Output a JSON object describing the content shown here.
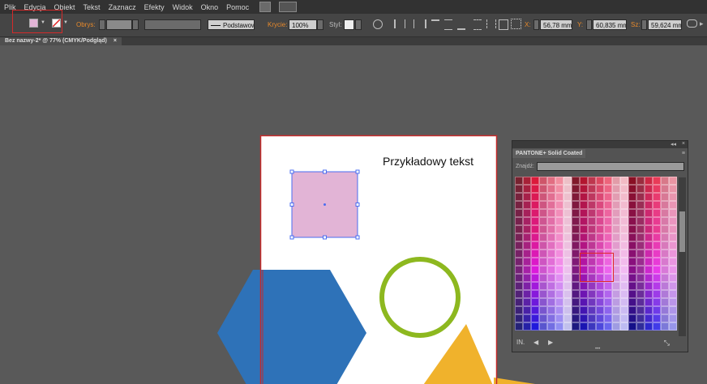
{
  "menu": {
    "items": [
      "Plik",
      "Edycja",
      "Obiekt",
      "Tekst",
      "Zaznacz",
      "Efekty",
      "Widok",
      "Okno",
      "Pomoc"
    ]
  },
  "control_bar": {
    "stroke_label": "Obrys:",
    "stroke_style_value": "Podstawowy",
    "opacity_label": "Krycie:",
    "opacity_value": "100%",
    "style_label": "Styl:",
    "x_label": "X:",
    "x_value": "56,78 mm",
    "y_label": "Y:",
    "y_value": "60,835 mm",
    "w_label": "Sz:",
    "w_value": "59,624 mm",
    "fill_color": "#e2b4d6",
    "highlight_color": "#d42a2a"
  },
  "document": {
    "tab_title": "Bez nazwy-2* @ 77% (CMYK/Podgląd)",
    "sample_text": "Przykładowy tekst",
    "rect_color": "#e2b4d6",
    "selection_color": "#4a6cf0",
    "hexagon_color": "#2e72b8",
    "circle_color": "#8db81f",
    "star_color": "#f0b22c",
    "artboard_border_color": "#c42a2a"
  },
  "swatch_panel": {
    "tab_label": "PANTONE+ Solid Coated",
    "search_label": "Znajdź:",
    "search_value": "",
    "menu_icon": "panel-menu-icon",
    "footer_icons": [
      "library-icon",
      "prev-icon",
      "next-icon",
      "resize-icon"
    ]
  }
}
